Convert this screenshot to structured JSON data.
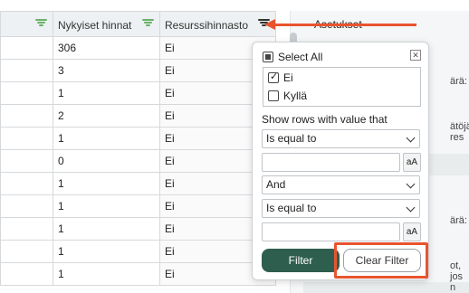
{
  "table": {
    "columns": [
      {
        "label": ""
      },
      {
        "label": "Nykyiset hinnat"
      },
      {
        "label": "Resurssihinnasto"
      }
    ],
    "rows": [
      [
        "",
        "306",
        "Ei"
      ],
      [
        "",
        "3",
        "Ei"
      ],
      [
        "",
        "1",
        "Ei"
      ],
      [
        "",
        "2",
        "Ei"
      ],
      [
        "",
        "1",
        "Ei"
      ],
      [
        "",
        "0",
        "Ei"
      ],
      [
        "",
        "1",
        "Ei"
      ],
      [
        "",
        "1",
        "Ei"
      ],
      [
        "",
        "1",
        "Ei"
      ],
      [
        "",
        "1",
        "Ei"
      ],
      [
        "",
        "1",
        "Ei"
      ]
    ]
  },
  "settings": {
    "title": "Asetukset",
    "fragments": [
      "ärä:",
      "ätöjä res",
      "ärä:",
      "ot, jos n"
    ]
  },
  "filter_popup": {
    "select_all_label": "Select All",
    "values": [
      {
        "label": "Ei",
        "checked": true
      },
      {
        "label": "Kyllä",
        "checked": false
      }
    ],
    "show_rows_label": "Show rows with value that",
    "condition1": "Is equal to",
    "value1": "",
    "operator": "And",
    "condition2": "Is equal to",
    "value2": "",
    "case_label": "aA",
    "filter_button": "Filter",
    "clear_button": "Clear Filter",
    "close_symbol": "✕"
  },
  "colors": {
    "accent_dark_green": "#2e5e4e",
    "annotation_red": "#e8542e",
    "filter_icon_green": "#6ab06a"
  }
}
